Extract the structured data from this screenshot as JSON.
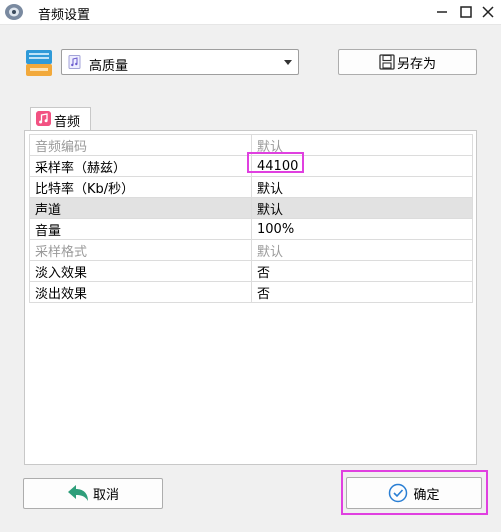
{
  "window": {
    "title": "音频设置",
    "controls": {
      "minimize": "—",
      "maximize": "☐",
      "close": "✕"
    }
  },
  "preset": {
    "selected": "高质量"
  },
  "toolbar": {
    "save_as_label": "另存为"
  },
  "tab": {
    "label": "音频"
  },
  "properties": [
    {
      "name": "音频编码",
      "value": "默认",
      "state": "disabled"
    },
    {
      "name": "采样率（赫兹）",
      "value": "44100",
      "state": "normal"
    },
    {
      "name": "比特率（Kb/秒）",
      "value": "默认",
      "state": "normal"
    },
    {
      "name": "声道",
      "value": "默认",
      "state": "selected"
    },
    {
      "name": "音量",
      "value": "100%",
      "state": "normal"
    },
    {
      "name": "采样格式",
      "value": "默认",
      "state": "disabled"
    },
    {
      "name": "淡入效果",
      "value": "否",
      "state": "normal"
    },
    {
      "name": "淡出效果",
      "value": "否",
      "state": "normal"
    }
  ],
  "footer": {
    "cancel_label": "取消",
    "ok_label": "确定"
  },
  "colors": {
    "highlight": "#e040e0",
    "selected_row": "#e2e2e2",
    "disabled_text": "#9a9a9a"
  }
}
